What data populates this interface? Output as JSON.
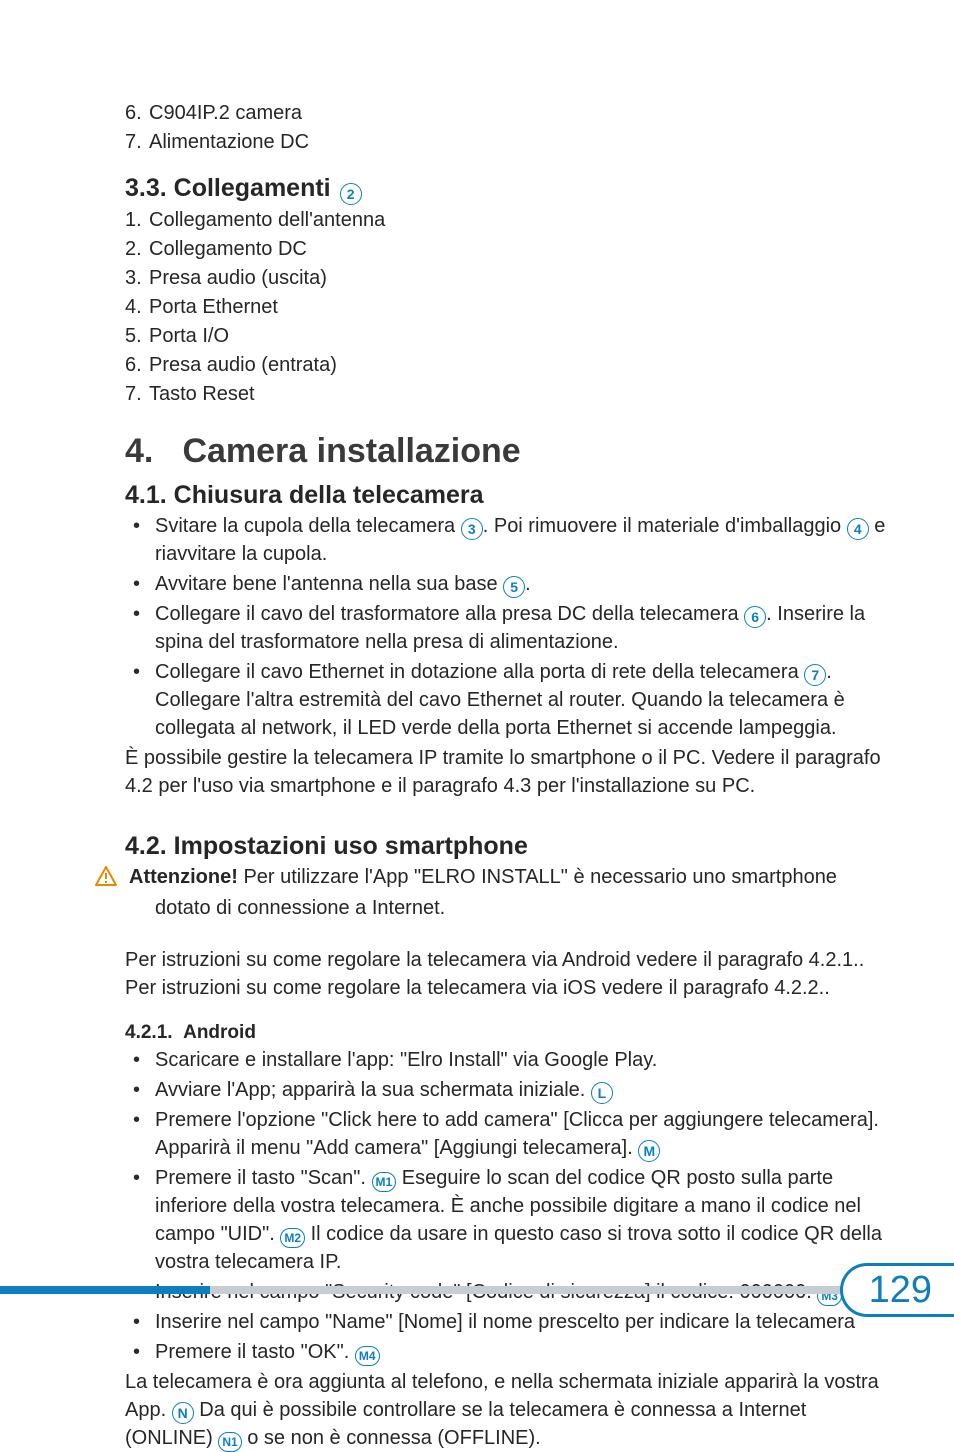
{
  "top_list": {
    "start": 6,
    "items": [
      "C904IP.2 camera",
      "Alimentazione DC"
    ]
  },
  "s33": {
    "num": "3.3.",
    "title": "Collegamenti",
    "badge": "2",
    "items": [
      "Collegamento dell'antenna",
      "Collegamento DC",
      "Presa audio (uscita)",
      "Porta Ethernet",
      "Porta I/O",
      "Presa audio (entrata)",
      "Tasto Reset"
    ]
  },
  "ch4": {
    "num": "4.",
    "title": "Camera installazione"
  },
  "s41": {
    "num": "4.1.",
    "title": "Chiusura della telecamera",
    "b1_a": "Svitare la cupola della telecamera ",
    "b1_badge1": "3",
    "b1_b": ". Poi rimuovere il materiale d'imballaggio ",
    "b1_badge2": "4",
    "b1_c": " e riavvitare la cupola.",
    "b2_a": "Avvitare bene l'antenna nella sua base ",
    "b2_badge": "5",
    "b2_b": ".",
    "b3_a": "Collegare il cavo del trasformatore alla presa DC della telecamera ",
    "b3_badge": "6",
    "b3_b": ". Inserire la spina del trasformatore nella presa di alimentazione.",
    "b4_a": "Collegare il cavo Ethernet in dotazione alla porta di rete della telecamera ",
    "b4_badge": "7",
    "b4_b": ". Collegare l'altra estremità del cavo Ethernet al router. Quando la telecamera è collegata al network, il LED verde della porta Ethernet si accende lampeggia.",
    "para": "È possibile gestire la telecamera IP tramite lo smartphone o il PC. Vedere il paragrafo 4.2 per l'uso via smartphone e il paragrafo 4.3 per l'installazione su PC."
  },
  "s42": {
    "num": "4.2.",
    "title": "Impostazioni uso smartphone",
    "warn_label": "Attenzione!",
    "warn_text": " Per utilizzare l'App \"ELRO INSTALL\" è necessario uno smartphone dotato di connessione a Internet.",
    "intro": "Per istruzioni su come regolare la telecamera via Android vedere il paragrafo 4.2.1.. Per istruzioni su come regolare la telecamera via iOS vedere il paragrafo 4.2.2.."
  },
  "s421": {
    "num": "4.2.1.",
    "title": "Android",
    "b1": "Scaricare e installare l'app: \"Elro Install\" via Google Play.",
    "b2_a": "Avviare l'App; apparirà la sua schermata iniziale. ",
    "b2_badge": "L",
    "b3_a": "Premere l'opzione \"Click here to add camera\" [Clicca per aggiungere telecamera]. Apparirà il menu \"Add camera\" [Aggiungi telecamera]. ",
    "b3_badge": "M",
    "b4_a": "Premere il tasto \"Scan\". ",
    "b4_badge1": "M1",
    "b4_b": " Eseguire lo scan del codice QR posto sulla parte inferiore della vostra telecamera. È anche possibile digitare a mano il codice nel campo \"UID\". ",
    "b4_badge2": "M2",
    "b4_c": " Il codice da usare in questo caso si trova sotto il codice QR della vostra telecamera IP.",
    "b5_a": "Inserire nel campo \"Security code\" [Codice di sicurezza] il codice: 000000. ",
    "b5_badge": "M3",
    "b6": "Inserire nel campo \"Name\" [Nome] il nome prescelto per indicare la telecamera",
    "b7_a": "Premere il tasto \"OK\". ",
    "b7_badge": "M4",
    "trail_a": "La telecamera è ora aggiunta al telefono, e nella schermata iniziale apparirà la vostra App. ",
    "trail_badge1": "N",
    "trail_b": " Da qui è possibile controllare se la telecamera è connessa a Internet (ONLINE) ",
    "trail_badge2": "N1",
    "trail_c": " o se non è connessa (OFFLINE)."
  },
  "page_number": "129"
}
